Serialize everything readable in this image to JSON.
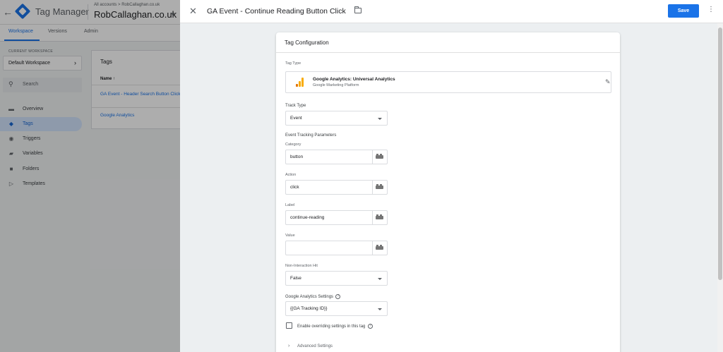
{
  "app": {
    "title": "Tag Manager",
    "accounts_line": "All accounts > RobCallaghan.co.uk",
    "container_name": "RobCallaghan.co.uk"
  },
  "tabs": [
    {
      "label": "Workspace",
      "active": true
    },
    {
      "label": "Versions",
      "active": false
    },
    {
      "label": "Admin",
      "active": false
    }
  ],
  "sidebar": {
    "current_workspace_label": "CURRENT WORKSPACE",
    "workspace_name": "Default Workspace",
    "search_placeholder": "Search",
    "items": [
      {
        "label": "Overview",
        "icon": "overview-icon",
        "active": false
      },
      {
        "label": "Tags",
        "icon": "tag-icon",
        "active": true
      },
      {
        "label": "Triggers",
        "icon": "trigger-icon",
        "active": false
      },
      {
        "label": "Variables",
        "icon": "variables-icon",
        "active": false
      },
      {
        "label": "Folders",
        "icon": "folder-icon",
        "active": false
      },
      {
        "label": "Templates",
        "icon": "template-icon",
        "active": false
      }
    ]
  },
  "tags_panel": {
    "title": "Tags",
    "column_header": "Name ↑",
    "rows": [
      "GA Event - Header Search Button Click",
      "Google Analytics"
    ]
  },
  "editor": {
    "title": "GA Event - Continue Reading Button Click",
    "save_label": "Save",
    "card_title": "Tag Configuration",
    "tag_type_label": "Tag Type",
    "tag_type_name": "Google Analytics: Universal Analytics",
    "tag_type_sub": "Google Marketing Platform",
    "track_type_label": "Track Type",
    "track_type_value": "Event",
    "event_params_label": "Event Tracking Parameters",
    "fields": [
      {
        "label": "Category",
        "value": "button"
      },
      {
        "label": "Action",
        "value": "click"
      },
      {
        "label": "Label",
        "value": "continue-reading"
      },
      {
        "label": "Value",
        "value": ""
      }
    ],
    "non_interaction_label": "Non-Interaction Hit",
    "non_interaction_value": "False",
    "ga_settings_label": "Google Analytics Settings",
    "ga_settings_value": "{{GA Tracking ID}}",
    "override_label": "Enable overriding settings in this tag",
    "override_checked": false,
    "advanced_label": "Advanced Settings"
  },
  "colors": {
    "accent": "#1a73e8",
    "analytics_orange": "#f9ab00",
    "analytics_dark": "#e37400"
  }
}
